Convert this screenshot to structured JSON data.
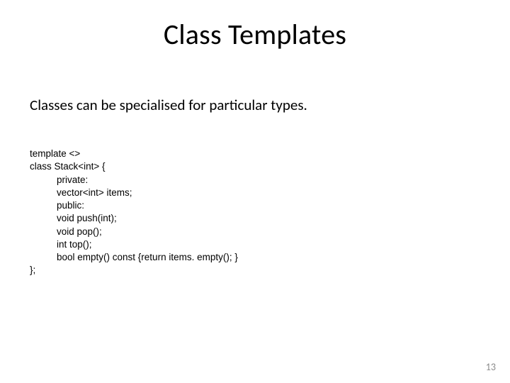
{
  "slide": {
    "title": "Class Templates",
    "subtitle": "Classes can be specialised for particular types.",
    "code": {
      "l0": "template <>",
      "l1": "class Stack<int> {",
      "l2": "private:",
      "l3": "vector<int> items;",
      "l4": "public:",
      "l5": "void push(int);",
      "l6": "void pop();",
      "l7": "int top();",
      "l8": "bool empty() const {return items. empty(); }",
      "l9": "};"
    },
    "page_number": "13"
  }
}
